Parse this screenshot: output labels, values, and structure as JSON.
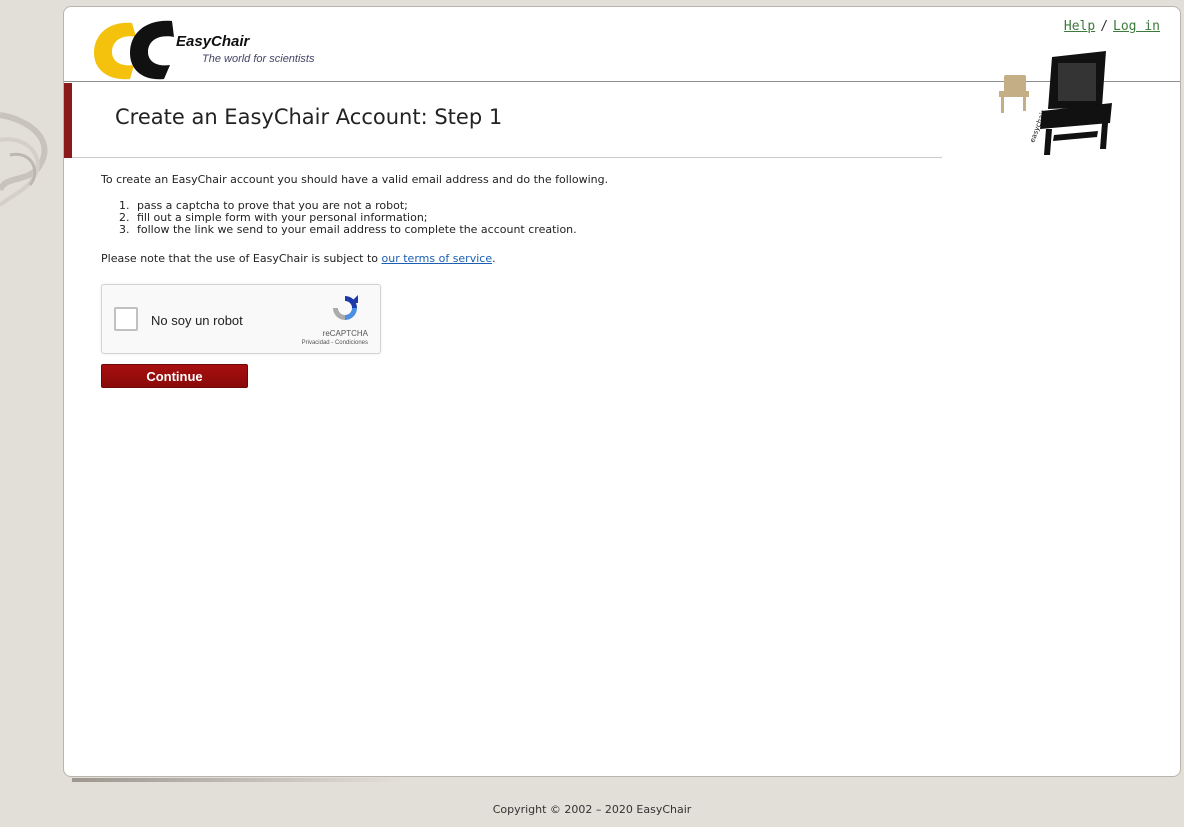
{
  "brand": {
    "name": "EasyChair",
    "tagline": "The world for scientists",
    "colors": {
      "yellow": "#f4c20d",
      "dark": "#111111",
      "title_accent": "#8b1a1a"
    }
  },
  "header": {
    "help_label": "Help",
    "separator": "/",
    "login_label": "Log in"
  },
  "page": {
    "title": "Create an EasyChair Account: Step 1",
    "intro": "To create an EasyChair account you should have a valid email address and do the following.",
    "steps": [
      {
        "num": "1.",
        "text": "pass a captcha to prove that you are not a robot;"
      },
      {
        "num": "2.",
        "text": "fill out a simple form with your personal information;"
      },
      {
        "num": "3.",
        "text": "follow the link we send to your email address to complete the account creation."
      }
    ],
    "terms_prefix": "Please note that the use of EasyChair is subject to ",
    "terms_link": "our terms of service",
    "terms_suffix": "."
  },
  "captcha": {
    "label": "No soy un robot",
    "brand": "reCAPTCHA",
    "legal": "Privacidad - Condiciones",
    "checked": false
  },
  "form": {
    "continue_label": "Continue",
    "button_color": "#9b0d0d"
  },
  "footer": {
    "copyright": "Copyright © 2002 – 2020 EasyChair"
  }
}
